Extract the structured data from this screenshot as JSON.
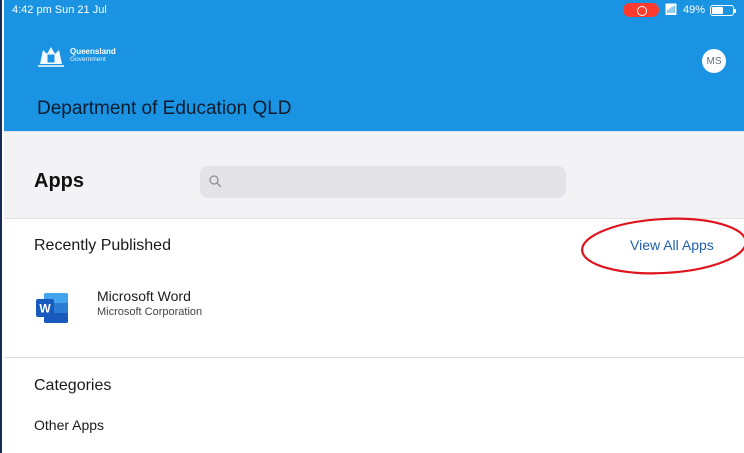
{
  "status_bar": {
    "time": "4:42 pm  Sun 21 Jul",
    "battery": "49%",
    "wifi_icon": "wifi-icon",
    "recording_icon": "screen-recording-icon"
  },
  "header": {
    "logo_line1": "Queensland",
    "logo_line2": "Government",
    "avatar_initials": "MS",
    "title": "Department of Education QLD",
    "bg_color": "#1a93e3"
  },
  "apps_bar": {
    "title": "Apps",
    "search_placeholder": "",
    "search_icon": "search-icon"
  },
  "recently_published": {
    "heading": "Recently Published",
    "view_all_label": "View All Apps",
    "apps": [
      {
        "name": "Microsoft Word",
        "vendor": "Microsoft Corporation",
        "icon": "microsoft-word-icon"
      }
    ]
  },
  "categories": {
    "heading": "Categories",
    "items": [
      "Other Apps"
    ]
  },
  "annotation": {
    "shape": "ellipse",
    "color": "#e0141e"
  }
}
